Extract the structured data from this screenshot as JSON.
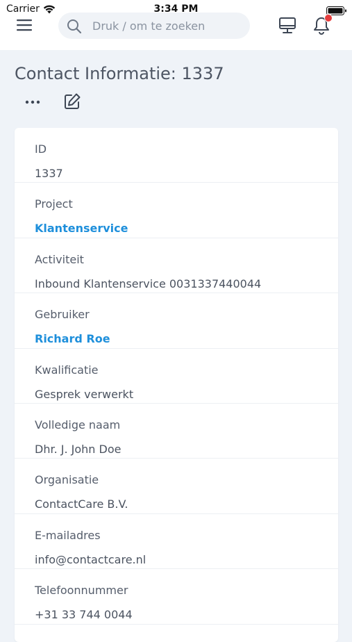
{
  "status_bar": {
    "carrier": "Carrier",
    "time": "3:34 PM"
  },
  "header": {
    "search_placeholder": "Druk / om te zoeken",
    "icons": [
      "hamburger-icon",
      "search-icon",
      "desktop-icon",
      "bell-icon"
    ],
    "notification_dot_color": "#e53d3d"
  },
  "page": {
    "title": "Contact Informatie: 1337",
    "actions": [
      "more-icon",
      "edit-icon"
    ]
  },
  "fields": [
    {
      "label": "ID",
      "value": "1337",
      "link": false
    },
    {
      "label": "Project",
      "value": "Klantenservice",
      "link": true
    },
    {
      "label": "Activiteit",
      "value": "Inbound Klantenservice 0031337440044",
      "link": false
    },
    {
      "label": "Gebruiker",
      "value": "Richard Roe",
      "link": true
    },
    {
      "label": "Kwalificatie",
      "value": "Gesprek verwerkt",
      "link": false
    },
    {
      "label": "Volledige naam",
      "value": "Dhr. J. John Doe",
      "link": false
    },
    {
      "label": "Organisatie",
      "value": "ContactCare B.V.",
      "link": false
    },
    {
      "label": "E-mailadres",
      "value": "info@contactcare.nl",
      "link": false
    },
    {
      "label": "Telefoonnummer",
      "value": "+31 33 744 0044",
      "link": false
    }
  ],
  "colors": {
    "link": "#1e8fdb",
    "background": "#eff3f8"
  }
}
